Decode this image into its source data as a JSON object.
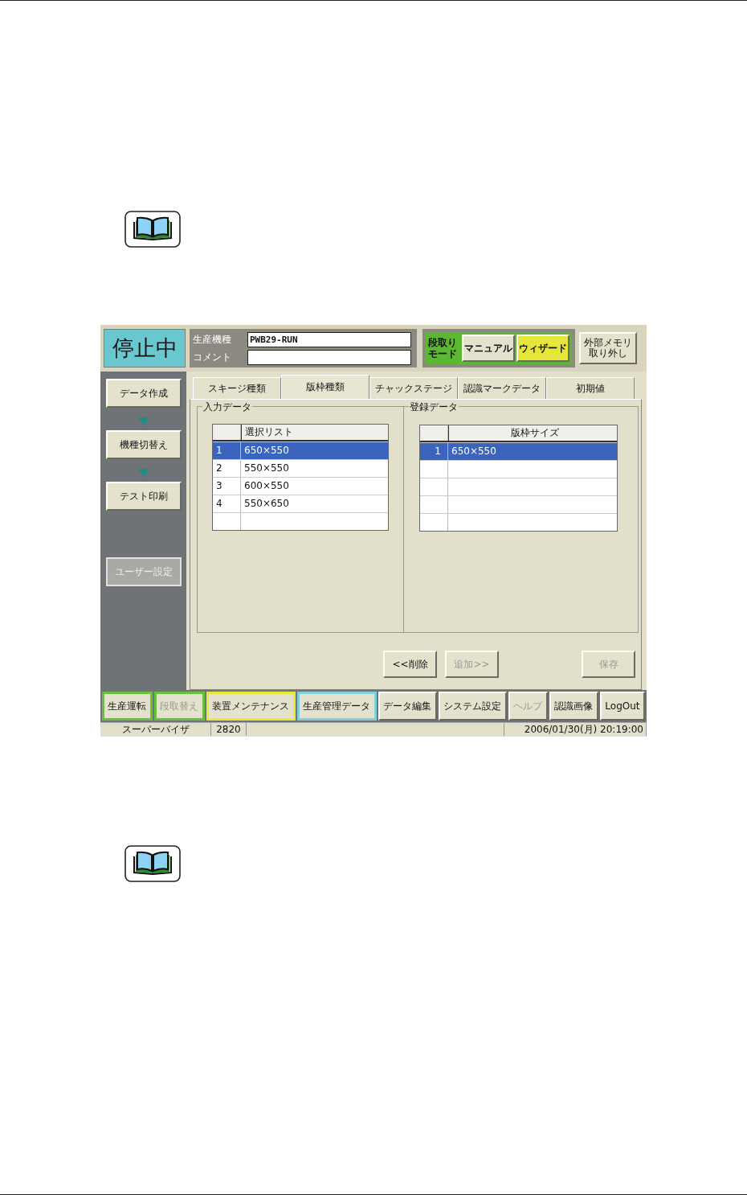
{
  "screen": {
    "status": "停止中",
    "fields": [
      {
        "label": "生産機種",
        "value": "PWB29-RUN"
      },
      {
        "label": "コメント"
      }
    ],
    "mode": {
      "label_lines": [
        "段取り",
        "モード"
      ],
      "options": [
        {
          "label": "マニュアル",
          "selected": false
        },
        {
          "label": "ウィザード",
          "selected": true
        }
      ]
    },
    "memory_button": [
      "外部メモリ",
      "取り外し"
    ],
    "steps": [
      {
        "label": "データ作成",
        "disabled": false
      },
      {
        "label": "機種切替え",
        "disabled": false
      },
      {
        "label": "テスト印刷",
        "disabled": false
      }
    ],
    "user_button": {
      "label": "ユーザー設定",
      "disabled": true
    },
    "tabs": [
      {
        "label": "スキージ種類",
        "selected": false
      },
      {
        "label": "版枠種類",
        "selected": true
      },
      {
        "label": "チャックステージ",
        "selected": false
      },
      {
        "label": "認識マークデータ",
        "selected": false
      },
      {
        "label": "初期値",
        "selected": false
      }
    ],
    "input_group": {
      "title": "入力データ",
      "column": "選択リスト",
      "rows": [
        {
          "no": "1",
          "value": "650×550",
          "selected": true
        },
        {
          "no": "2",
          "value": "550×550",
          "selected": false
        },
        {
          "no": "3",
          "value": "600×550",
          "selected": false
        },
        {
          "no": "4",
          "value": "550×650",
          "selected": false
        }
      ]
    },
    "registered_group": {
      "title": "登録データ",
      "column": "版枠サイズ",
      "rows": [
        {
          "no": "1",
          "value": "650×550",
          "selected": true
        }
      ]
    },
    "actions": [
      {
        "label": "<<削除",
        "disabled": false
      },
      {
        "label": "追加>>",
        "disabled": true
      },
      {
        "label": "保存",
        "disabled": true
      }
    ],
    "nav": [
      {
        "label": "生産運転",
        "disabled": false,
        "color": "#66c23a"
      },
      {
        "label": "段取替え",
        "disabled": true,
        "color": "#66c23a"
      },
      {
        "label": "装置メンテナンス",
        "disabled": false,
        "color": "#e8e83a"
      },
      {
        "label": "生産管理データ",
        "disabled": false,
        "color": "#7fd0dc"
      },
      {
        "label": "データ編集",
        "disabled": false
      },
      {
        "label": "システム設定",
        "disabled": false
      },
      {
        "label": "ヘルプ",
        "disabled": true
      },
      {
        "label": "認識画像",
        "disabled": false
      },
      {
        "label": "LogOut",
        "disabled": false
      }
    ],
    "status_bar": {
      "user": "スーパーバイザ",
      "code": "2820",
      "datetime": "2006/01/30(月) 20:19:00"
    }
  }
}
